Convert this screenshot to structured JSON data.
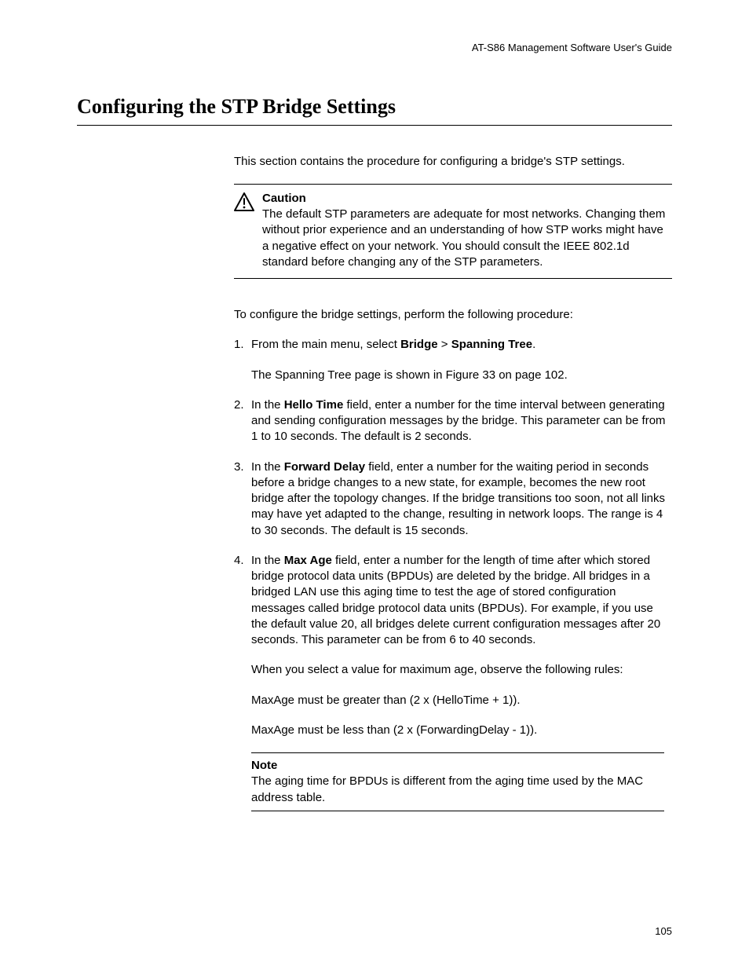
{
  "running_header": "AT-S86 Management Software User's Guide",
  "section_heading": "Configuring the STP Bridge Settings",
  "intro": "This section contains the procedure for configuring a bridge's STP settings.",
  "caution": {
    "label": "Caution",
    "text": "The default STP parameters are adequate for most networks. Changing them without prior experience and an understanding of how STP works might have a negative effect on your network. You should consult the IEEE 802.1d standard before changing any of the STP parameters."
  },
  "transition": "To configure the bridge settings, perform the following procedure:",
  "steps": {
    "s1": {
      "num": "1.",
      "pre": "From the main menu, select ",
      "b1": "Bridge",
      "mid": " > ",
      "b2": "Spanning Tree",
      "post": ".",
      "sub": "The Spanning Tree page is shown in Figure 33 on page 102."
    },
    "s2": {
      "num": "2.",
      "pre": "In the ",
      "b1": "Hello Time",
      "post": " field, enter a number for the time interval between generating and sending configuration messages by the bridge. This parameter can be from 1 to 10 seconds. The default is 2 seconds."
    },
    "s3": {
      "num": "3.",
      "pre": "In the ",
      "b1": "Forward Delay",
      "post": " field, enter a number for the waiting period in seconds before a bridge changes to a new state, for example, becomes the new root bridge after the topology changes. If the bridge transitions too soon, not all links may have yet adapted to the change, resulting in network loops. The range is 4 to 30 seconds. The default is 15 seconds."
    },
    "s4": {
      "num": "4.",
      "pre": "In the ",
      "b1": "Max Age",
      "post": " field, enter a number for the length of time after which stored bridge protocol data units (BPDUs) are deleted by the bridge. All bridges in a bridged LAN use this aging time to test the age of stored configuration messages called bridge protocol data units (BPDUs). For example, if you use the default value 20, all bridges delete current configuration messages after 20 seconds. This parameter can be from 6 to 40 seconds.",
      "sub1": "When you select a value for maximum age, observe the following rules:",
      "sub2": "MaxAge must be greater than (2 x (HelloTime + 1)).",
      "sub3": "MaxAge must be less than (2 x (ForwardingDelay - 1))."
    }
  },
  "note": {
    "label": "Note",
    "text": "The aging time for BPDUs is different from the aging time used by the MAC address table."
  },
  "page_number": "105"
}
